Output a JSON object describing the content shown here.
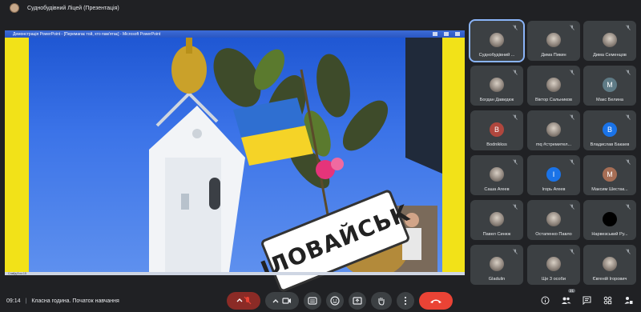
{
  "window": {
    "title": "Суднобудівний Ліцей (Презентація)"
  },
  "presentation": {
    "titlebar": "Демонстрація PowerPoint - [Перемагає той, хто пам'ятає] - Microsoft PowerPoint",
    "status_text": "Слайд 8 из 15",
    "slide_sign": "ІЛОВАЙСЬК"
  },
  "participants": [
    {
      "name": "Суднобудівний ...",
      "initial": "",
      "avatar": "photo",
      "active": true
    },
    {
      "name": "Дима Пикин",
      "initial": "",
      "avatar": "photo"
    },
    {
      "name": "Дима Семенцов",
      "initial": "",
      "avatar": "photo"
    },
    {
      "name": "Богдан Давидюк",
      "initial": "",
      "avatar": "photo"
    },
    {
      "name": "Віктор Сальников",
      "initial": "",
      "avatar": "photo"
    },
    {
      "name": "Макс Белина",
      "initial": "M",
      "color": "#5f7b86"
    },
    {
      "name": "Bodnikkss",
      "initial": "B",
      "color": "#b0473e"
    },
    {
      "name": "mq #стремител...",
      "initial": "",
      "avatar": "photo"
    },
    {
      "name": "Владислав Бакаев",
      "initial": "B",
      "color": "#1a73e8"
    },
    {
      "name": "Саша Агеев",
      "initial": "",
      "avatar": "photo"
    },
    {
      "name": "Ігорь Агеев",
      "initial": "I",
      "color": "#1a73e8"
    },
    {
      "name": "Максим Шестак...",
      "initial": "M",
      "color": "#a66e55"
    },
    {
      "name": "Павел Синюк",
      "initial": "",
      "avatar": "photo"
    },
    {
      "name": "Остапенко Павло",
      "initial": "",
      "avatar": "photo"
    },
    {
      "name": "Нарвезський Ру...",
      "initial": "",
      "avatar": "dark"
    },
    {
      "name": "Gladulin",
      "initial": "",
      "avatar": "photo"
    },
    {
      "name": "Ще 3 особи",
      "initial": "",
      "avatar": "photo"
    },
    {
      "name": "Євгеній Ігорович",
      "initial": "",
      "avatar": "photo"
    }
  ],
  "bottom": {
    "time": "09:14",
    "separator": "|",
    "meeting_title": "Класна година. Початок навчання",
    "participant_count": "21"
  },
  "colors": {
    "background": "#202124",
    "tile": "#3c4043",
    "end_call": "#ea4335",
    "active_border": "#8ab4f8"
  }
}
